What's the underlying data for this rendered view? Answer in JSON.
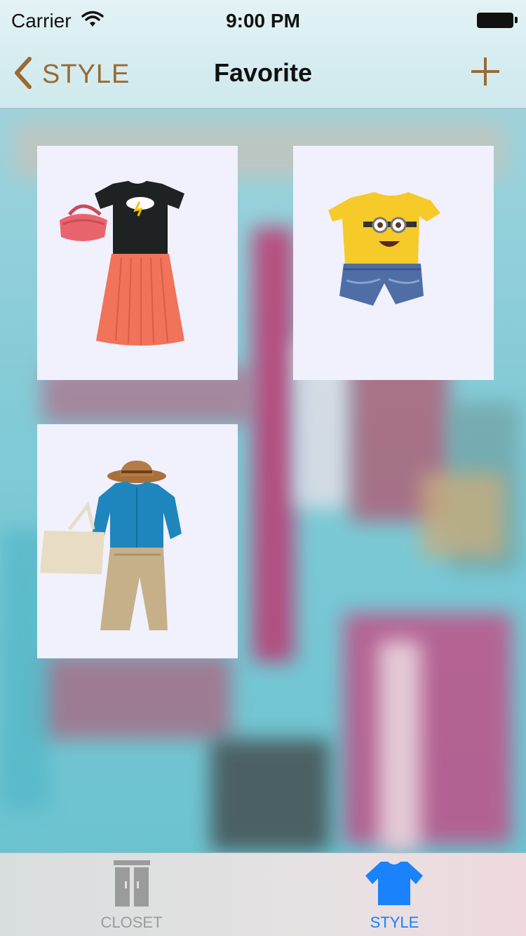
{
  "status_bar": {
    "carrier": "Carrier",
    "time": "9:00 PM"
  },
  "nav": {
    "back_label": "STYLE",
    "title": "Favorite",
    "accent": "#9a6a34"
  },
  "outfits": [
    {
      "items": [
        "handbag-icon",
        "tshirt-icon",
        "skirt-icon"
      ]
    },
    {
      "items": [
        "tshirt-icon",
        "shorts-icon"
      ]
    },
    {
      "items": [
        "hat-icon",
        "shirt-icon",
        "tote-bag-icon",
        "pants-icon"
      ]
    }
  ],
  "tabs": [
    {
      "label": "CLOSET",
      "icon": "closet-icon",
      "selected": false,
      "color": "#9b9b9b"
    },
    {
      "label": "STYLE",
      "icon": "tshirt-icon",
      "selected": true,
      "color": "#1a82fb"
    }
  ]
}
